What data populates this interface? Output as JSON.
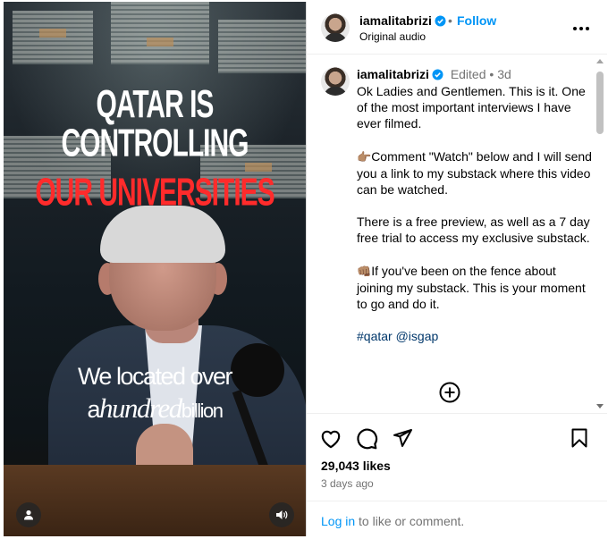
{
  "media": {
    "headline_line1": "QATAR IS CONTROLLING",
    "headline_line2": "OUR UNIVERSITIES",
    "subtitle_line1": "We located over",
    "subtitle_a": "a",
    "subtitle_big": "hundred",
    "subtitle_small": "billion",
    "headline_color": "#ff2b2b"
  },
  "header": {
    "username": "iamalitabrizi",
    "dot": "•",
    "follow_label": "Follow",
    "audio": "Original audio"
  },
  "caption": {
    "username": "iamalitabrizi",
    "edited": "Edited",
    "dot": "•",
    "time": "3d",
    "p1": "Ok Ladies and Gentlemen. This is it. One of the most important interviews I have ever filmed.",
    "p2_emoji": "👉🏽",
    "p2": "Comment \"Watch\" below and I will send you a link to my substack where this video can be watched.",
    "p3": "There is a free preview, as well as a 7 day free trial to access my exclusive substack.",
    "p4_emoji": "👊🏽",
    "p4": "If you've been on the fence about joining my substack. This is your moment to go and do it.",
    "hashtag": "#qatar",
    "mention": "@isgap"
  },
  "engagement": {
    "likes": "29,043 likes",
    "ago": "3 days ago",
    "login_link": "Log in",
    "login_rest": " to like or comment."
  },
  "colors": {
    "accent": "#0095f6",
    "link": "#00376b",
    "muted": "#737373"
  }
}
